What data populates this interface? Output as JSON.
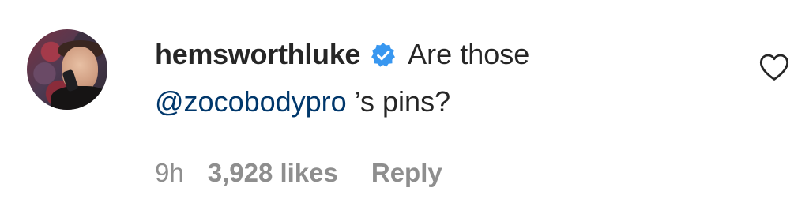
{
  "comment": {
    "username": "hemsworthluke",
    "verified": true,
    "text_part1": "Are those",
    "mention": "@zocobodypro",
    "text_part2": "’s pins?",
    "timestamp": "9h",
    "likes": "3,928 likes",
    "reply_label": "Reply"
  },
  "icons": {
    "verified": "verified-badge-icon",
    "like": "heart-outline-icon"
  },
  "colors": {
    "text": "#262626",
    "mention": "#00376b",
    "meta": "#8e8e8e",
    "verified": "#3897f0"
  }
}
